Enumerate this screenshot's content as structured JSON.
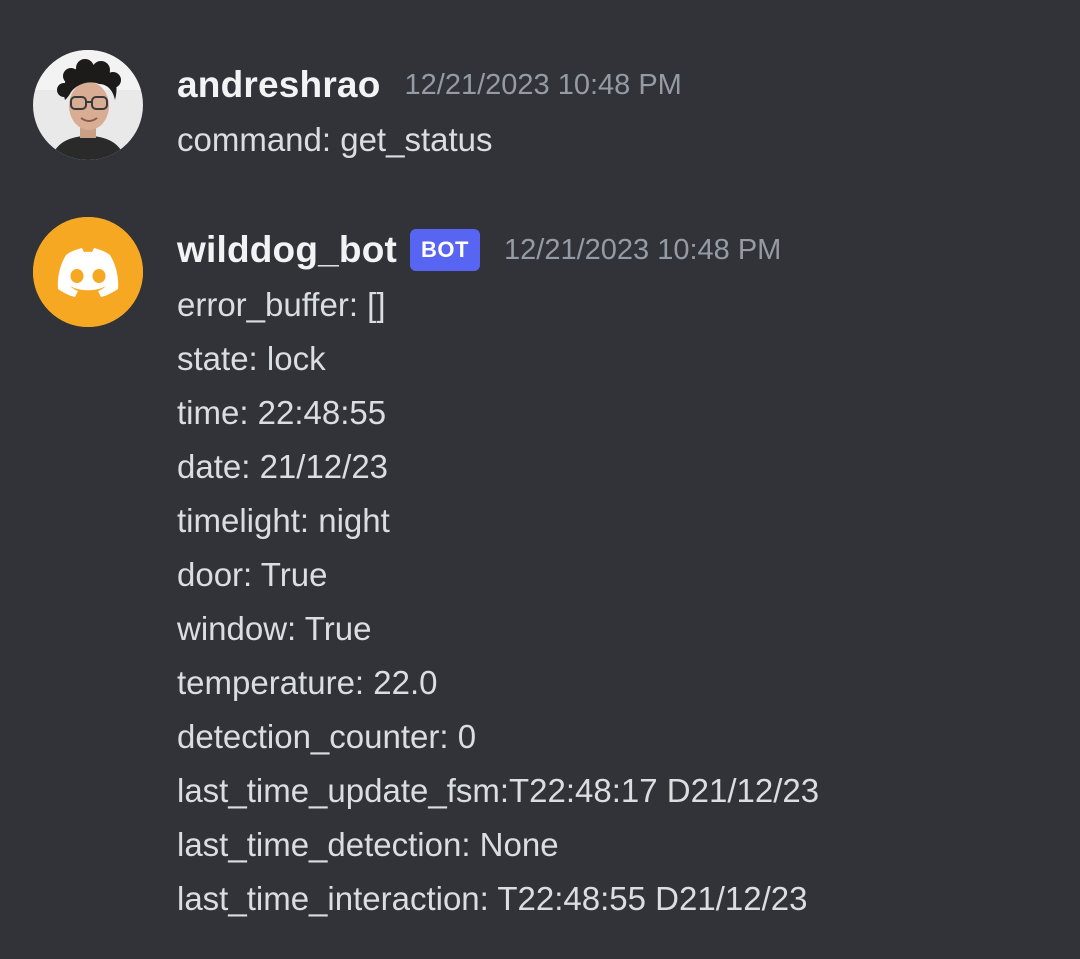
{
  "colors": {
    "background": "#313338",
    "username": "#f2f3f5",
    "message_text": "#dbdee1",
    "timestamp": "#949ba4",
    "bot_tag_bg": "#5865f2",
    "bot_avatar_bg": "#f6a823"
  },
  "messages": [
    {
      "author": "andreshrao",
      "avatar_icon": "user-photo-avatar",
      "timestamp": "12/21/2023 10:48 PM",
      "is_bot": false,
      "lines": [
        "command: get_status"
      ]
    },
    {
      "author": "wilddog_bot",
      "avatar_icon": "discord-logo-icon",
      "bot_tag": "BOT",
      "timestamp": "12/21/2023 10:48 PM",
      "is_bot": true,
      "lines": [
        "error_buffer: []",
        "state: lock",
        "time: 22:48:55",
        "date: 21/12/23",
        "timelight: night",
        "door: True",
        "window: True",
        "temperature: 22.0",
        "detection_counter: 0",
        "last_time_update_fsm:T22:48:17 D21/12/23",
        "last_time_detection: None",
        "last_time_interaction: T22:48:55 D21/12/23"
      ]
    }
  ]
}
